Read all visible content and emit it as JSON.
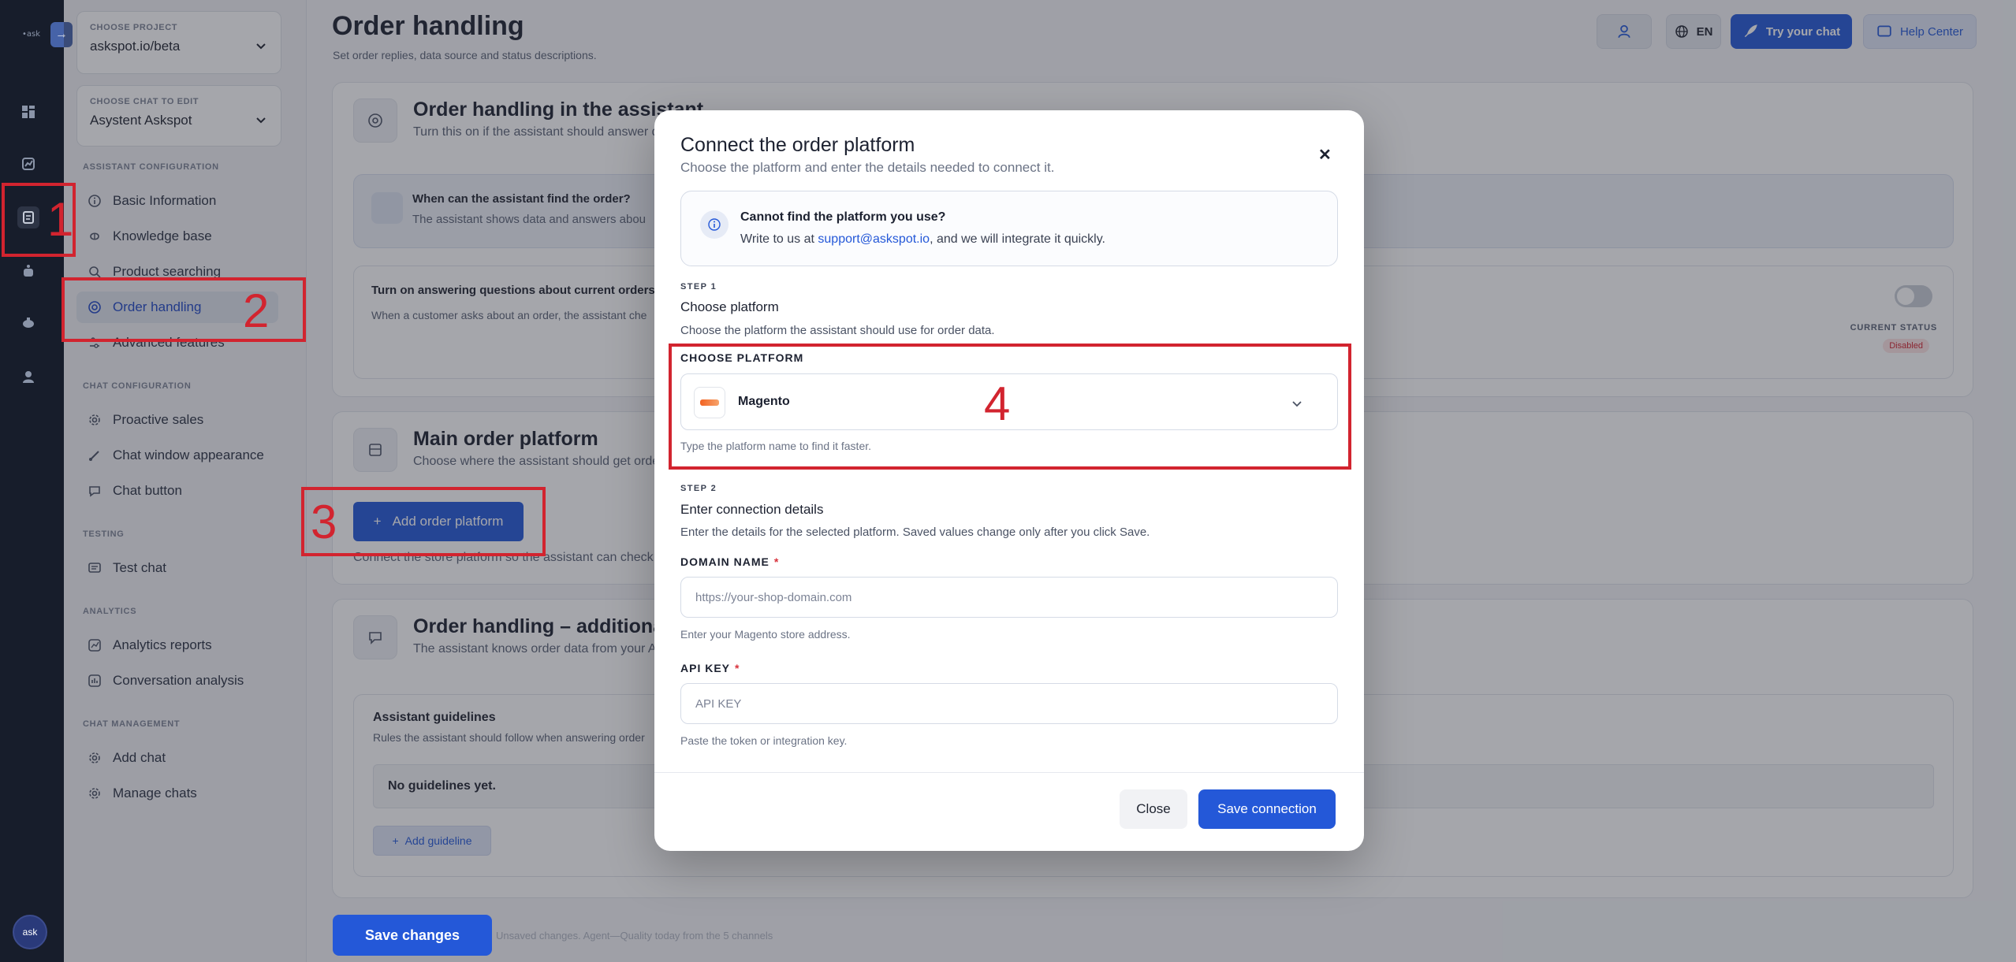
{
  "rail": {
    "logo_text": "•ask",
    "avatar_text": "ask"
  },
  "sidebar": {
    "project": {
      "caption": "CHOOSE PROJECT",
      "value": "askspot.io/beta"
    },
    "chat": {
      "caption": "CHOOSE CHAT TO EDIT",
      "value": "Asystent Askspot"
    },
    "sections": [
      {
        "label": "ASSISTANT CONFIGURATION",
        "items": [
          {
            "label": "Basic Information",
            "icon": "info-circle-icon"
          },
          {
            "label": "Knowledge base",
            "icon": "brain-icon"
          },
          {
            "label": "Product searching",
            "icon": "search-icon"
          },
          {
            "label": "Order handling",
            "icon": "order-icon",
            "active": true
          },
          {
            "label": "Advanced features",
            "icon": "sliders-icon"
          }
        ]
      },
      {
        "label": "CHAT CONFIGURATION",
        "items": [
          {
            "label": "Proactive sales",
            "icon": "gear-icon"
          },
          {
            "label": "Chat window appearance",
            "icon": "brush-icon"
          },
          {
            "label": "Chat button",
            "icon": "chat-button-icon"
          }
        ]
      },
      {
        "label": "TESTING",
        "items": [
          {
            "label": "Test chat",
            "icon": "chat-icon"
          }
        ]
      },
      {
        "label": "ANALYTICS",
        "items": [
          {
            "label": "Analytics reports",
            "icon": "report-icon"
          },
          {
            "label": "Conversation analysis",
            "icon": "analysis-icon"
          }
        ]
      },
      {
        "label": "CHAT MANAGEMENT",
        "items": [
          {
            "label": "Add chat",
            "icon": "gear-icon"
          },
          {
            "label": "Manage chats",
            "icon": "gear-icon"
          }
        ]
      }
    ]
  },
  "header": {
    "title": "Order handling",
    "subtitle": "Set order replies, data source and status descriptions.",
    "lang": "EN",
    "try_chat": "Try your chat",
    "help_center": "Help Center"
  },
  "cards": {
    "assistant": {
      "title": "Order handling in the assistant",
      "subtitle": "Turn this on if the assistant should answer q",
      "when_title": "When can the assistant find the order?",
      "when_body": "The assistant shows data and answers abou",
      "toggle_title": "Turn on answering questions about current orders",
      "toggle_body": "When a customer asks about an order, the assistant che",
      "status_label": "CURRENT STATUS",
      "status_value": "Disabled"
    },
    "platform": {
      "title": "Main order platform",
      "subtitle": "Choose where the assistant should get orde",
      "add_button": "Add order platform",
      "note": "Connect the store platform so the assistant can check o"
    },
    "additional": {
      "title": "Order handling – additional in",
      "subtitle": "The assistant knows order data from your A",
      "guidelines_title": "Assistant guidelines",
      "guidelines_body": "Rules the assistant should follow when answering order",
      "empty": "No guidelines yet.",
      "add_guideline": "Add guideline"
    },
    "save_changes": "Save changes",
    "footer_faint": "Unsaved changes. Agent—Quality today from the 5 channels"
  },
  "modal": {
    "title": "Connect the order platform",
    "subtitle": "Choose the platform and enter the details needed to connect it.",
    "info_title": "Cannot find the platform you use?",
    "info_prefix": "Write to us at ",
    "info_email": "support@askspot.io",
    "info_suffix": ", and we will integrate it quickly.",
    "step1": {
      "label": "STEP 1",
      "title": "Choose platform",
      "desc": "Choose the platform the assistant should use for order data."
    },
    "platform_label": "CHOOSE PLATFORM",
    "platform_value": "Magento",
    "platform_hint": "Type the platform name to find it faster.",
    "step2": {
      "label": "STEP 2",
      "title": "Enter connection details",
      "desc": "Enter the details for the selected platform. Saved values change only after you click Save."
    },
    "domain": {
      "label": "DOMAIN NAME",
      "required": "*",
      "placeholder": "https://your-shop-domain.com",
      "value": "",
      "hint": "Enter your Magento store address."
    },
    "api_key": {
      "label": "API KEY",
      "required": "*",
      "placeholder": "API KEY",
      "value": "",
      "hint": "Paste the token or integration key."
    },
    "close": "Close",
    "save": "Save connection"
  },
  "annotations": [
    "1",
    "2",
    "3",
    "4"
  ],
  "colors": {
    "primary": "#2458d8",
    "annotation": "#d2242f",
    "rail": "#171d2b",
    "disabled_badge": "#fde3e3"
  }
}
